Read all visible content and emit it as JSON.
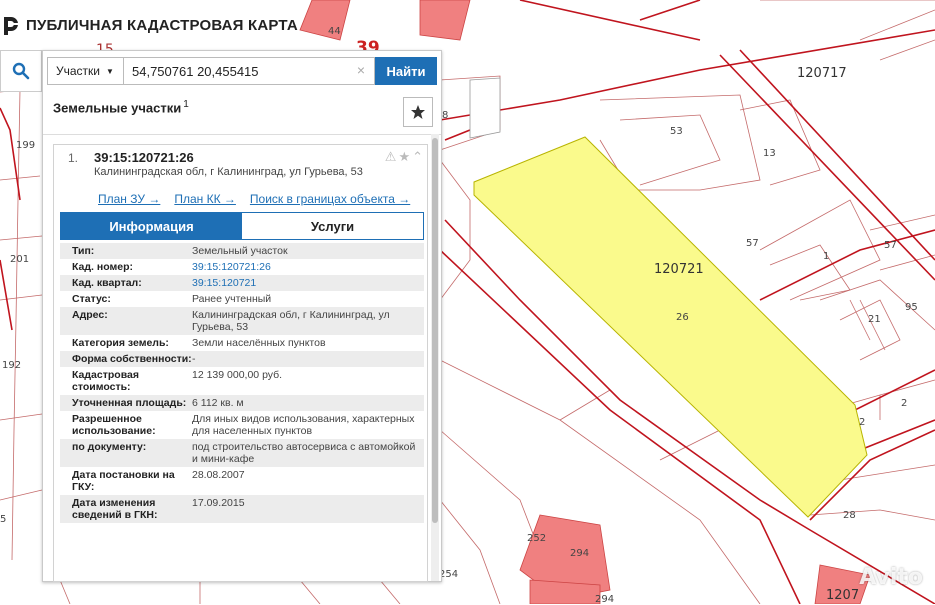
{
  "app": {
    "title": "ПУБЛИЧНАЯ КАДАСТРОВАЯ КАРТА"
  },
  "search": {
    "filter_label": "Участки",
    "value": "54,750761 20,455415",
    "find_label": "Найти",
    "clear_symbol": "×"
  },
  "results": {
    "header": "Земельные участки",
    "count": "1"
  },
  "card": {
    "index": "1.",
    "cad_number": "39:15:120721:26",
    "address_short": "Калининградская обл, г Калининград, ул Гурьева, 53",
    "links": [
      {
        "label": "План ЗУ →"
      },
      {
        "label": "План КК →"
      },
      {
        "label": "Поиск в границах объекта →"
      }
    ],
    "tabs": [
      {
        "label": "Информация",
        "active": true
      },
      {
        "label": "Услуги",
        "active": false
      }
    ],
    "properties": [
      {
        "key": "Тип:",
        "value": "Земельный участок",
        "link": false
      },
      {
        "key": "Кад. номер:",
        "value": "39:15:120721:26",
        "link": true
      },
      {
        "key": "Кад. квартал:",
        "value": "39:15:120721",
        "link": true
      },
      {
        "key": "Статус:",
        "value": "Ранее учтенный",
        "link": false
      },
      {
        "key": "Адрес:",
        "value": "Калининградская обл, г Калининград, ул Гурьева, 53",
        "link": false
      },
      {
        "key": "Категория земель:",
        "value": "Земли населённых пунктов",
        "link": false
      },
      {
        "key": "Форма собственности:",
        "value": "-",
        "link": false
      },
      {
        "key": "Кадастровая стоимость:",
        "value": "12 139 000,00 руб.",
        "link": false
      },
      {
        "key": "Уточненная площадь:",
        "value": "6 112 кв. м",
        "link": false
      },
      {
        "key": "Разрешенное использование:",
        "value": "Для иных видов использования, характерных для населенных пунктов",
        "link": false
      },
      {
        "key": "по документу:",
        "value": "под строительство автосервиса с автомойкой и мини-кафе",
        "link": false
      },
      {
        "key": "Дата постановки на ГКУ:",
        "value": "28.08.2007",
        "link": false
      },
      {
        "key": "Дата изменения сведений в ГКН:",
        "value": "17.09.2015",
        "link": false
      }
    ]
  },
  "map": {
    "labels": [
      {
        "id": "l120717",
        "text": "120717"
      },
      {
        "id": "l120721",
        "text": "120721"
      },
      {
        "id": "l26",
        "text": "26"
      },
      {
        "id": "l53",
        "text": "53"
      },
      {
        "id": "l13",
        "text": "13"
      },
      {
        "id": "l57a",
        "text": "57"
      },
      {
        "id": "l57b",
        "text": "57"
      },
      {
        "id": "l1",
        "text": "1"
      },
      {
        "id": "l21",
        "text": "21"
      },
      {
        "id": "l95",
        "text": "95"
      },
      {
        "id": "l2a",
        "text": "2"
      },
      {
        "id": "l2b",
        "text": "2"
      },
      {
        "id": "l28",
        "text": "28"
      },
      {
        "id": "l252",
        "text": "252"
      },
      {
        "id": "l294a",
        "text": "294"
      },
      {
        "id": "l294b",
        "text": "294"
      },
      {
        "id": "l254",
        "text": "254"
      },
      {
        "id": "l44",
        "text": "44"
      },
      {
        "id": "l39",
        "text": "39"
      },
      {
        "id": "l15",
        "text": "15"
      },
      {
        "id": "l199",
        "text": "199"
      },
      {
        "id": "l201",
        "text": "201"
      },
      {
        "id": "l192",
        "text": "192"
      },
      {
        "id": "l8",
        "text": "8"
      },
      {
        "id": "l5",
        "text": "5"
      },
      {
        "id": "l1207",
        "text": "1207"
      }
    ],
    "watermark": "Avito"
  },
  "colors": {
    "accent": "#1e6fb5",
    "parcel_fill": "#fafa8c",
    "building_fill": "#f08080",
    "boundary": "#c0141e"
  }
}
